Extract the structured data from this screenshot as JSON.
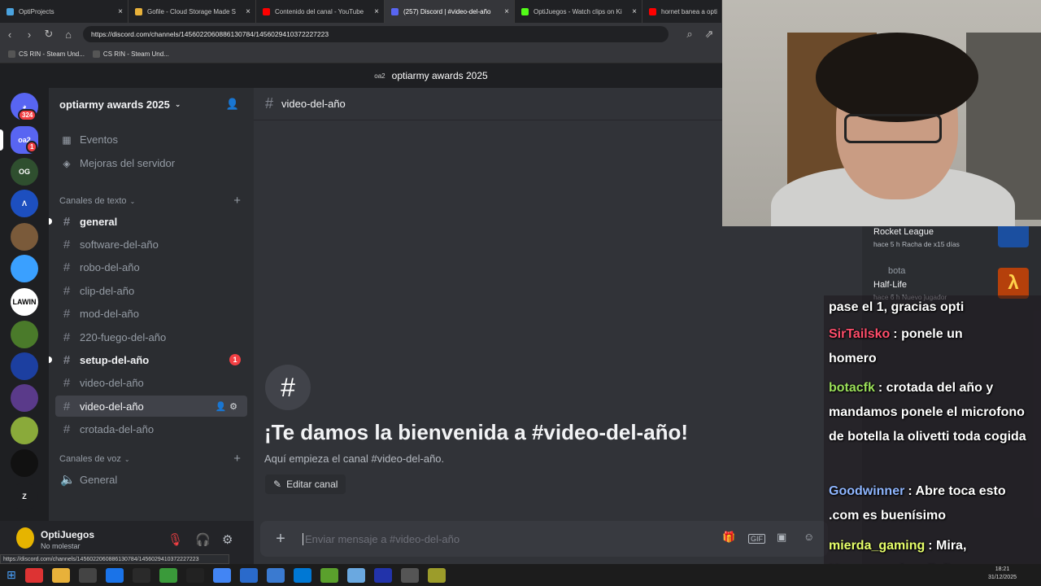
{
  "browser": {
    "tabs": [
      {
        "label": "OptiProjects",
        "color": "#4aa3df"
      },
      {
        "label": "Gofile - Cloud Storage Made S",
        "color": "#e8b13a"
      },
      {
        "label": "Contenido del canal - YouTube",
        "color": "#ff0000"
      },
      {
        "label": "(257) Discord | #video-del-año",
        "color": "#5865f2"
      },
      {
        "label": "OptiJuegos - Watch clips on Ki",
        "color": "#53fc18"
      },
      {
        "label": "hornet banea a opti",
        "color": "#ff0000"
      }
    ],
    "active_tab": 3,
    "url": "https://discord.com/channels/1456022060886130784/1456029410372227223",
    "bookmarks": [
      "CS RIN - Steam Und...",
      "CS RIN - Steam Und..."
    ],
    "status_url": "https://discord.com/channels/1456022060886130784/1456029410372227223"
  },
  "discord": {
    "top_title": "optiarmy awards 2025",
    "top_server_icon": "oa2",
    "rail": {
      "home_badge": "324",
      "servers": [
        {
          "label": "oa2",
          "color": "#5865f2",
          "badge": "1"
        },
        {
          "label": "OG",
          "color": "#2f4f2f"
        },
        {
          "label": "Λ",
          "color": "#1d4fbf"
        },
        {
          "label": "",
          "color": "#7a5a3a"
        },
        {
          "label": "",
          "color": "#3aa0ff"
        },
        {
          "label": "LAWIN",
          "color": "#ffffff"
        },
        {
          "label": "",
          "color": "#4a7a2a"
        },
        {
          "label": "",
          "color": "#1c3fa0"
        },
        {
          "label": "",
          "color": "#5a3a8a"
        },
        {
          "label": "",
          "color": "#8aaa3a"
        },
        {
          "label": "",
          "color": "#111111"
        },
        {
          "label": "Z",
          "color": "#1e1f22"
        }
      ]
    },
    "server_name": "optiarmy awards 2025",
    "events_label": "Eventos",
    "boost_label": "Mejoras del servidor",
    "text_category": "Canales de texto",
    "channels": [
      {
        "name": "general",
        "unread": true
      },
      {
        "name": "software-del-año"
      },
      {
        "name": "robo-del-año"
      },
      {
        "name": "clip-del-año"
      },
      {
        "name": "mod-del-año"
      },
      {
        "name": "220-fuego-del-año"
      },
      {
        "name": "setup-del-año",
        "unread": true,
        "mentions": "1"
      },
      {
        "name": "video-del-año"
      },
      {
        "name": "video-del-año",
        "selected": true
      },
      {
        "name": "crotada-del-año"
      }
    ],
    "voice_category": "Canales de voz",
    "voice_channels": [
      "General"
    ],
    "user": {
      "name": "OptiJuegos",
      "status": "No molestar"
    },
    "chat": {
      "channel": "video-del-año",
      "welcome_title": "¡Te damos la bienvenida a #video-del-año!",
      "welcome_sub": "Aquí empieza el canal #video-del-año.",
      "edit_button": "Editar canal",
      "composer_placeholder": "Enviar mensaje a #video-del-año"
    },
    "members": {
      "activity1_game": "Rocket League",
      "activity1_meta": "hace 5 h   Racha de x15 días",
      "activity2_user": "bota",
      "activity2_game": "Half-Life",
      "activity2_meta": "hace 6 h   Nuevo jugador"
    }
  },
  "stream_chat": [
    {
      "user": "",
      "user_color": "#ffffff",
      "text": "pase el 1, gracias opti"
    },
    {
      "user": "SirTailsko",
      "user_color": "#ff4d6a",
      "text": ": ponele un homero"
    },
    {
      "user": "botacfk",
      "user_color": "#9be05a",
      "text": ": crotada del año y mandamos ponele el microfono de botella la olivetti toda cogida"
    },
    {
      "user": "Goodwinner",
      "user_color": "#8fb6ff",
      "text": ": Abre toca esto .com es buenísimo"
    },
    {
      "user": "mierda_gaming",
      "user_color": "#e6ff6a",
      "text": ": Mira, Marge, soy brasileño"
    }
  ],
  "taskbar": {
    "time": "18:21",
    "date": "31/12/2025"
  }
}
